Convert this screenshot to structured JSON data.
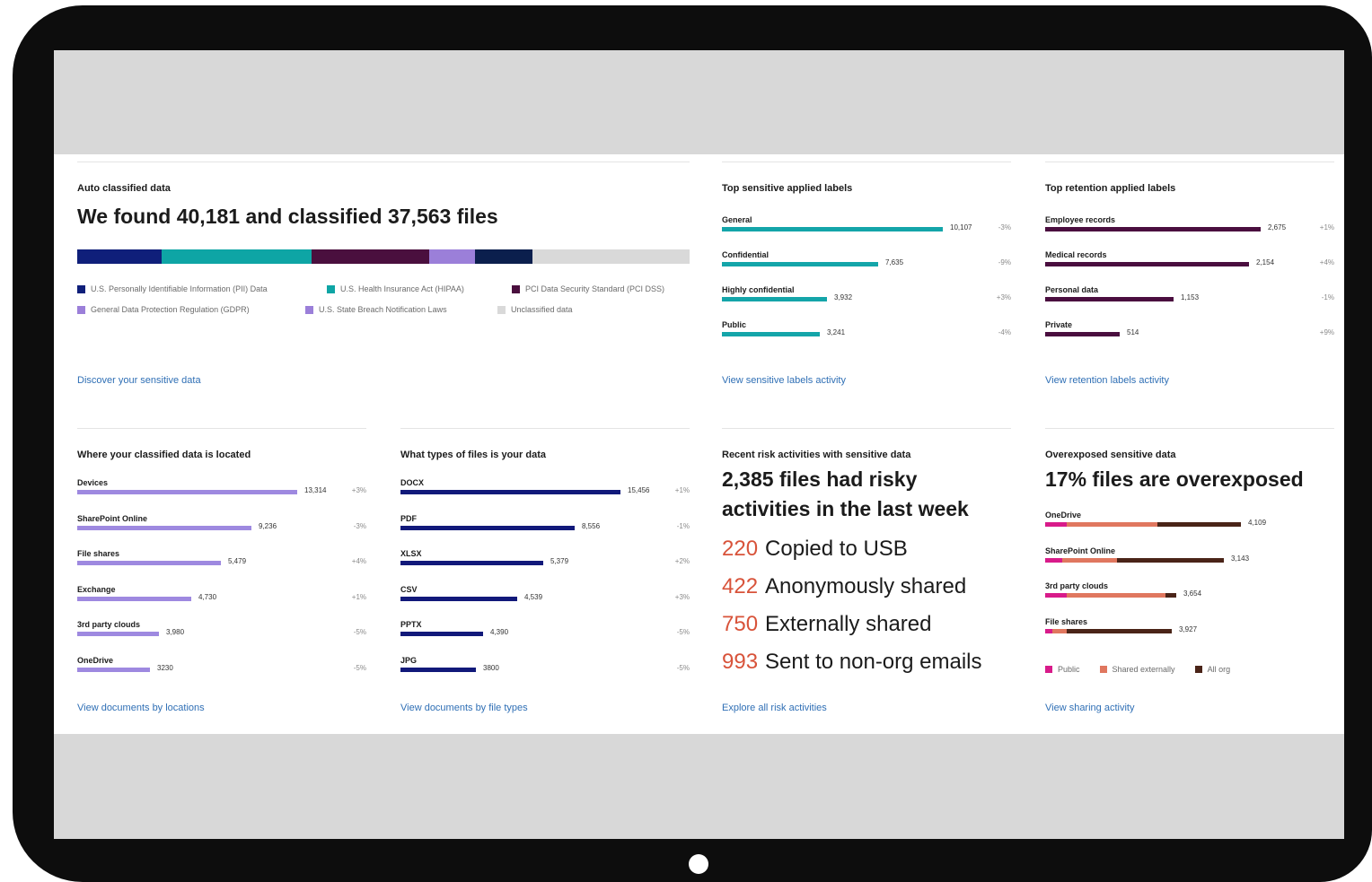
{
  "colors": {
    "pii": "#0f1f7a",
    "hipaa": "#0ea5a5",
    "pci": "#4a0f3e",
    "gdpr": "#9b7fd9",
    "breach": "#0b1f4d",
    "unclassified": "#d9d9d9",
    "teal": "#14a5a9",
    "plum": "#4a0e3f",
    "lavender": "#9e89e0",
    "navy": "#11197a",
    "public": "#d81b8a",
    "shared": "#e0775f",
    "allorg": "#4a2418",
    "link": "#2f6fb5",
    "riskNum": "#d8533a"
  },
  "auto": {
    "title": "Auto classified data",
    "headline": "We found 40,181 and classified 37,563 files",
    "segments": [
      {
        "key": "pii",
        "share": 0.138
      },
      {
        "key": "hipaa",
        "share": 0.245
      },
      {
        "key": "pci",
        "share": 0.192
      },
      {
        "key": "gdpr",
        "share": 0.075
      },
      {
        "key": "breach",
        "share": 0.093
      },
      {
        "key": "unclassified",
        "share": 0.257
      }
    ],
    "legend": [
      {
        "label": "U.S. Personally Identifiable Information (PII) Data",
        "color": "pii"
      },
      {
        "label": "U.S. Health Insurance Act (HIPAA)",
        "color": "hipaa"
      },
      {
        "label": "PCI Data Security Standard (PCI DSS)",
        "color": "pci"
      },
      {
        "label": "General Data Protection Regulation (GDPR)",
        "color": "gdpr"
      },
      {
        "label": "U.S. State Breach Notification Laws",
        "color": "gdpr"
      },
      {
        "label": "Unclassified data",
        "color": "unclassified"
      }
    ],
    "link": "Discover your sensitive data"
  },
  "sensitive": {
    "title": "Top sensitive applied labels",
    "rows": [
      {
        "label": "General",
        "value": "10,107",
        "change": "-3%",
        "fraction": 1.0
      },
      {
        "label": "Confidential",
        "value": "7,635",
        "change": "-9%",
        "fraction": 0.708
      },
      {
        "label": "Highly confidential",
        "value": "3,932",
        "change": "+3%",
        "fraction": 0.474
      },
      {
        "label": "Public",
        "value": "3,241",
        "change": "-4%",
        "fraction": 0.444
      }
    ],
    "link": "View sensitive labels activity"
  },
  "retention": {
    "title": "Top retention applied labels",
    "rows": [
      {
        "label": "Employee records",
        "value": "2,675",
        "change": "+1%",
        "fraction": 1.0
      },
      {
        "label": "Medical records",
        "value": "2,154",
        "change": "+4%",
        "fraction": 0.947
      },
      {
        "label": "Personal data",
        "value": "1,153",
        "change": "-1%",
        "fraction": 0.594
      },
      {
        "label": "Private",
        "value": "514",
        "change": "+9%",
        "fraction": 0.345
      }
    ],
    "link": "View retention labels activity"
  },
  "locations": {
    "title": "Where your classified data is located",
    "rows": [
      {
        "label": "Devices",
        "value": "13,314",
        "change": "+3%",
        "fraction": 1.0
      },
      {
        "label": "SharePoint Online",
        "value": "9,236",
        "change": "-3%",
        "fraction": 0.791
      },
      {
        "label": "File shares",
        "value": "5,479",
        "change": "+4%",
        "fraction": 0.652
      },
      {
        "label": "Exchange",
        "value": "4,730",
        "change": "+1%",
        "fraction": 0.52
      },
      {
        "label": "3rd party clouds",
        "value": "3,980",
        "change": "-5%",
        "fraction": 0.372
      },
      {
        "label": "OneDrive",
        "value": "3230",
        "change": "-5%",
        "fraction": 0.332
      }
    ],
    "link": "View documents by locations"
  },
  "types": {
    "title": "What types of files is your data",
    "rows": [
      {
        "label": "DOCX",
        "value": "15,456",
        "change": "+1%",
        "fraction": 1.0
      },
      {
        "label": "PDF",
        "value": "8,556",
        "change": "-1%",
        "fraction": 0.793
      },
      {
        "label": "XLSX",
        "value": "5,379",
        "change": "+2%",
        "fraction": 0.649
      },
      {
        "label": "CSV",
        "value": "4,539",
        "change": "+3%",
        "fraction": 0.531
      },
      {
        "label": "PPTX",
        "value": "4,390",
        "change": "-5%",
        "fraction": 0.374
      },
      {
        "label": "JPG",
        "value": "3800",
        "change": "-5%",
        "fraction": 0.341
      }
    ],
    "link": "View documents by file types"
  },
  "risk": {
    "title": "Recent risk activities with sensitive data",
    "headline_line1": "2,385 files had risky",
    "headline_line2": "activities in the last week",
    "items": [
      {
        "num": "220",
        "text": "Copied to USB"
      },
      {
        "num": "422",
        "text": "Anonymously shared"
      },
      {
        "num": "750",
        "text": "Externally shared"
      },
      {
        "num": "993",
        "text": "Sent to non-org emails"
      }
    ],
    "link": "Explore all risk activities"
  },
  "overexposed": {
    "title": "Overexposed sensitive data",
    "headline": "17% files are overexposed",
    "rows": [
      {
        "label": "OneDrive",
        "value": "4,109",
        "public": 0.082,
        "shared": 0.35,
        "allorg": 0.323
      },
      {
        "label": "SharePoint Online",
        "value": "3,143",
        "public": 0.067,
        "shared": 0.212,
        "allorg": 0.413
      },
      {
        "label": "3rd party clouds",
        "value": "3,654",
        "public": 0.082,
        "shared": 0.383,
        "allorg": 0.043
      },
      {
        "label": "File shares",
        "value": "3,927",
        "public": 0.027,
        "shared": 0.056,
        "allorg": 0.405
      }
    ],
    "legend": [
      {
        "label": "Public",
        "color": "public"
      },
      {
        "label": "Shared externally",
        "color": "shared"
      },
      {
        "label": "All org",
        "color": "allorg"
      }
    ],
    "link": "View sharing activity"
  }
}
